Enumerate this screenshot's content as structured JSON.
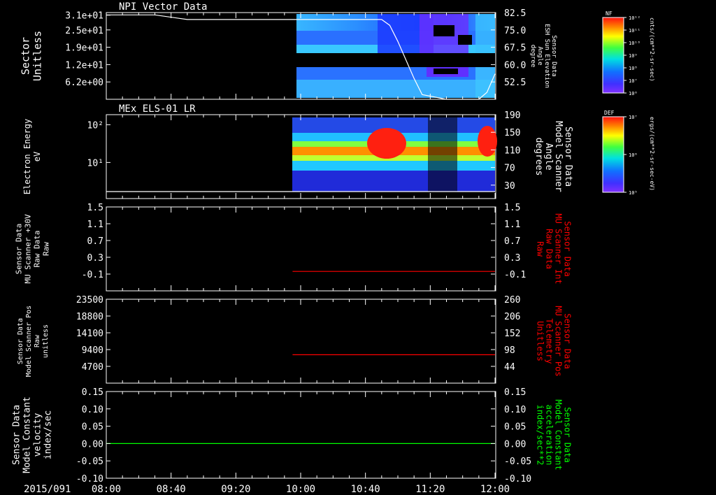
{
  "date": "2015/091",
  "time_ticks": [
    "08:00",
    "08:40",
    "09:20",
    "10:00",
    "10:40",
    "11:20",
    "12:00"
  ],
  "colors": {
    "background": "#000000",
    "foreground": "#ffffff",
    "red_trace": "#ff0000",
    "green_trace": "#00ff00"
  },
  "chart_data": [
    {
      "type": "heatmap",
      "panel_title": "NPI Vector Data",
      "left_axis": {
        "label": [
          "Sector",
          "Unitless"
        ],
        "ticks": [
          "3.1e+01",
          "2.5e+01",
          "1.9e+01",
          "1.2e+01",
          "6.2e+00"
        ]
      },
      "right_axis": {
        "label": [
          "Sensor Data",
          "ESH Sun Elevation",
          "Angle",
          "degree"
        ],
        "ticks": [
          "82.5",
          "75.0",
          "67.5",
          "60.0",
          "52.5"
        ],
        "ylim": [
          45,
          82.5
        ]
      },
      "colorbar": {
        "title": "NF",
        "ticks": [
          "10¹²",
          "10¹¹",
          "10¹⁰",
          "10⁹",
          "10⁸",
          "10⁷",
          "10⁶"
        ],
        "unit": "cnts/(cm**2-sr-sec)"
      },
      "overlay_line": {
        "name": "ESH Sun Elevation",
        "x": [
          "08:00",
          "08:30",
          "08:50",
          "10:00",
          "10:50",
          "10:55",
          "11:00",
          "11:05",
          "11:10",
          "11:15",
          "11:30",
          "11:40",
          "11:50",
          "11:55",
          "12:00"
        ],
        "y": [
          81.5,
          81.5,
          79.5,
          79.5,
          79.5,
          77,
          70,
          62,
          54,
          47,
          45,
          45,
          45,
          48,
          56
        ]
      },
      "data_start": "10:00"
    },
    {
      "type": "heatmap",
      "panel_title": "MEx ELS-01 LR",
      "left_axis": {
        "label": [
          "Electron Energy",
          "eV"
        ],
        "ticks": [
          "10²",
          "10¹"
        ],
        "scale": "log"
      },
      "right_axis": {
        "label": [
          "Sensor Data",
          "Model Scanner",
          "Angle",
          "degrees"
        ],
        "ticks": [
          "190",
          "150",
          "110",
          "70",
          "30"
        ],
        "ylim": [
          0,
          190
        ]
      },
      "colorbar": {
        "title": "DEF",
        "ticks": [
          "10⁷",
          "10⁶",
          "10⁵"
        ],
        "unit": "ergs/(cm**2-sr-sec-eV)"
      },
      "overlay_line": {
        "name": "Model Scanner Angle",
        "x": [
          "08:00",
          "12:00"
        ],
        "y": [
          0,
          0
        ]
      },
      "data_start": "09:58"
    },
    {
      "type": "line",
      "left_axis": {
        "label": [
          "Sensor Data",
          "MU Scanner +30V",
          "Raw Data",
          "Raw"
        ],
        "ticks": [
          "1.5",
          "1.1",
          "0.7",
          "0.3",
          "-0.1"
        ],
        "ylim": [
          -0.4,
          1.5
        ]
      },
      "right_axis": {
        "label": [
          "Sensor Data",
          "MU Scanner Int",
          "Raw Data",
          "Raw"
        ],
        "ticks": [
          "1.5",
          "1.1",
          "0.7",
          "0.3",
          "-0.1"
        ],
        "ylim": [
          -0.4,
          1.5
        ]
      },
      "series": [
        {
          "color": "#ff0000",
          "x": [
            "09:55",
            "12:00"
          ],
          "y": [
            0.04,
            0.04
          ]
        }
      ]
    },
    {
      "type": "line",
      "left_axis": {
        "label": [
          "Sensor Data",
          "Model Scanner Pos",
          "Raw",
          "unitless"
        ],
        "ticks": [
          "23500",
          "18800",
          "14100",
          "9400",
          "4700"
        ],
        "ylim": [
          0,
          23500
        ]
      },
      "right_axis": {
        "label": [
          "Sensor Data",
          "MU Scanner Pos",
          "Telemetry",
          "Unitless"
        ],
        "ticks": [
          "260",
          "206",
          "152",
          "98",
          "44"
        ],
        "ylim": [
          0,
          260
        ]
      },
      "series": [
        {
          "color": "#ff0000",
          "x": [
            "09:55",
            "12:00"
          ],
          "y": [
            88,
            88
          ]
        }
      ]
    },
    {
      "type": "line",
      "left_axis": {
        "label": [
          "Sensor Data",
          "Model Constant",
          "velocity",
          "index/sec"
        ],
        "ticks": [
          "0.15",
          "0.10",
          "0.05",
          "0.00",
          "-0.05",
          "-0.10"
        ],
        "ylim": [
          -0.1,
          0.15
        ]
      },
      "right_axis": {
        "label": [
          "Sensor Data",
          "Model Constant",
          "acceleration",
          "index/sec**2"
        ],
        "ticks": [
          "0.15",
          "0.10",
          "0.05",
          "0.00",
          "-0.05",
          "-0.10"
        ],
        "ylim": [
          -0.1,
          0.15
        ]
      },
      "series": [
        {
          "color": "#00ff00",
          "x": [
            "08:00",
            "12:00"
          ],
          "y": [
            0,
            0
          ]
        }
      ]
    }
  ]
}
